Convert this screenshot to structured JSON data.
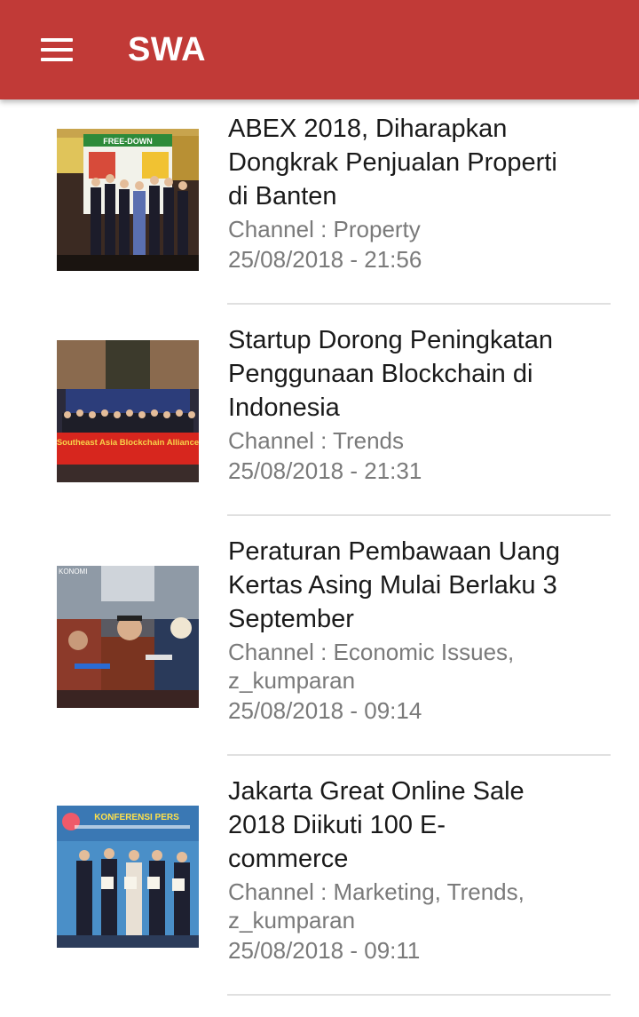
{
  "app": {
    "title": "SWA"
  },
  "articles": [
    {
      "title": "ABEX 2018, Diharapkan Dongkrak Penjualan Properti di Banten",
      "channel": "Channel : Property",
      "date": "25/08/2018 - 21:56"
    },
    {
      "title": "Startup Dorong Peningkatan Penggunaan Blockchain di Indonesia",
      "channel": "Channel : Trends",
      "date": "25/08/2018 - 21:31"
    },
    {
      "title": "Peraturan Pembawaan Uang Kertas Asing Mulai Berlaku 3 September",
      "channel": "Channel : Economic Issues, z_kumparan",
      "date": "25/08/2018 - 09:14"
    },
    {
      "title": "Jakarta Great Online Sale 2018 Diikuti 100 E-commerce",
      "channel": "Channel : Marketing, Trends, z_kumparan",
      "date": "25/08/2018 - 09:11"
    }
  ],
  "thumb_text": {
    "a1_banner": "FREE-DOWN",
    "a2_banner": "Southeast Asia Blockchain Alliance",
    "a3_label": "KONOMI",
    "a4_banner": "KONFERENSI PERS"
  }
}
